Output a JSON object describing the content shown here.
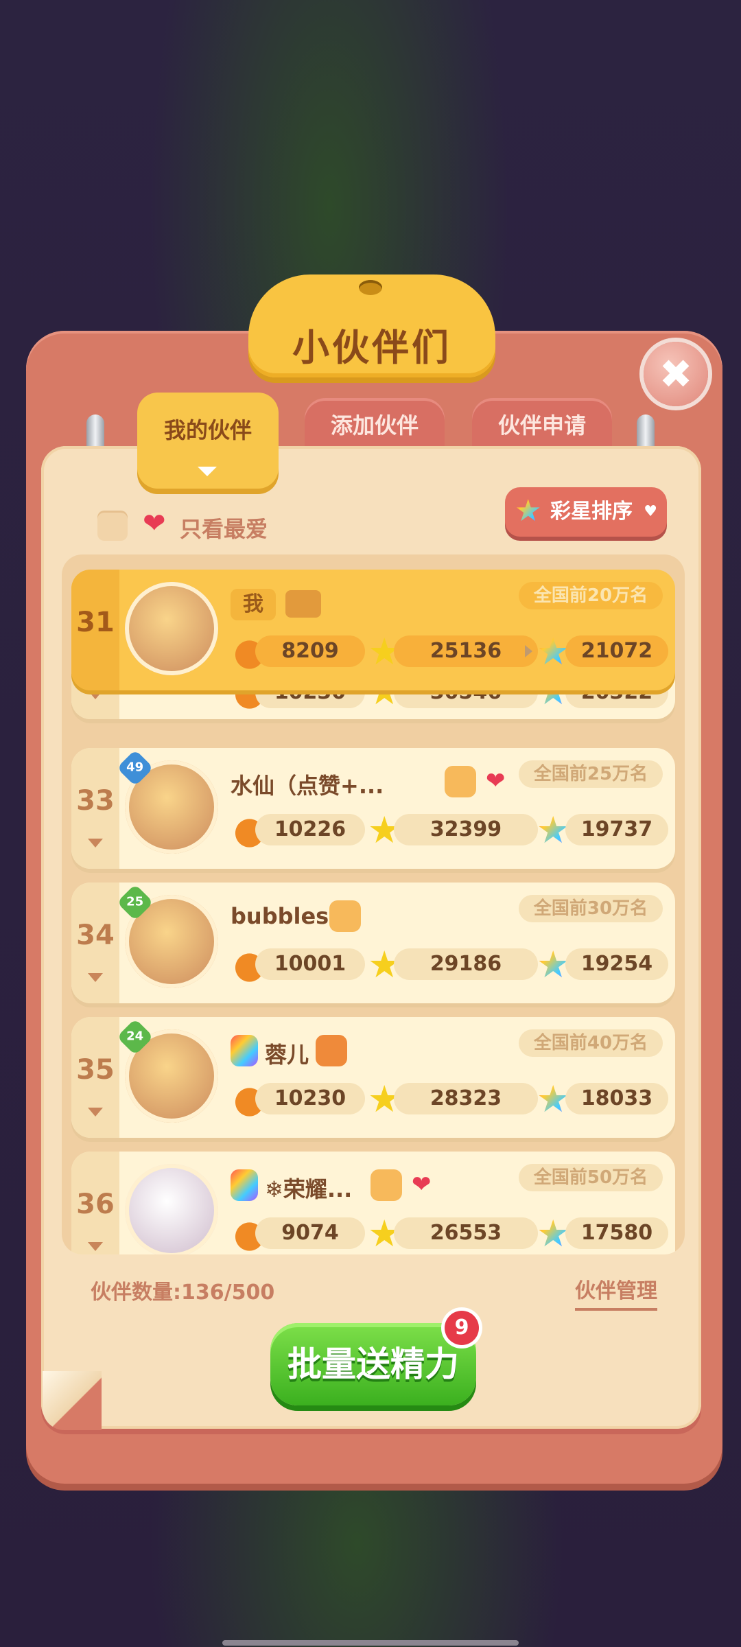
{
  "title": "小伙伴们",
  "close_icon": "✖",
  "tabs": [
    {
      "label": "我的伙伴",
      "active": true
    },
    {
      "label": "添加伙伴",
      "active": false
    },
    {
      "label": "伙伴申请",
      "active": false
    }
  ],
  "filter": {
    "label": "只看最爱",
    "heart": "❤"
  },
  "sort_button": {
    "label": "彩星排序",
    "caret": "♥",
    "star": "★"
  },
  "icons": {
    "onion": "●",
    "star": "★",
    "rainbow_star": "★"
  },
  "me_row": {
    "rank": "31",
    "badge": "我",
    "top_rank": "全国前20万名",
    "energy": "8209",
    "stars": "25136",
    "rainbow": "21072"
  },
  "hidden_row": {
    "energy": "10230",
    "stars": "30546",
    "rainbow": "20322"
  },
  "friends": [
    {
      "rank": "33",
      "level": "49",
      "name": "水仙（点赞+...",
      "heart": "❤",
      "top_rank": "全国前25万名",
      "energy": "10226",
      "stars": "32399",
      "rainbow": "19737"
    },
    {
      "rank": "34",
      "level": "25",
      "name": "bubbles",
      "heart": "",
      "top_rank": "全国前30万名",
      "energy": "10001",
      "stars": "29186",
      "rainbow": "19254"
    },
    {
      "rank": "35",
      "level": "24",
      "name": "蓉儿",
      "heart": "",
      "top_rank": "全国前40万名",
      "energy": "10230",
      "stars": "28323",
      "rainbow": "18033"
    },
    {
      "rank": "36",
      "level": "",
      "name": "❄荣耀...",
      "heart": "❤",
      "top_rank": "全国前50万名",
      "energy": "9074",
      "stars": "26553",
      "rainbow": "17580"
    }
  ],
  "footer": {
    "count": "伙伴数量:136/500",
    "manage": "伙伴管理"
  },
  "send_button": {
    "label": "批量送精力",
    "badge": "9"
  },
  "colors": {
    "panel": "#d77a66",
    "sheet": "#f7e0bd",
    "accent": "#f9c441",
    "send": "#3bb01f"
  }
}
